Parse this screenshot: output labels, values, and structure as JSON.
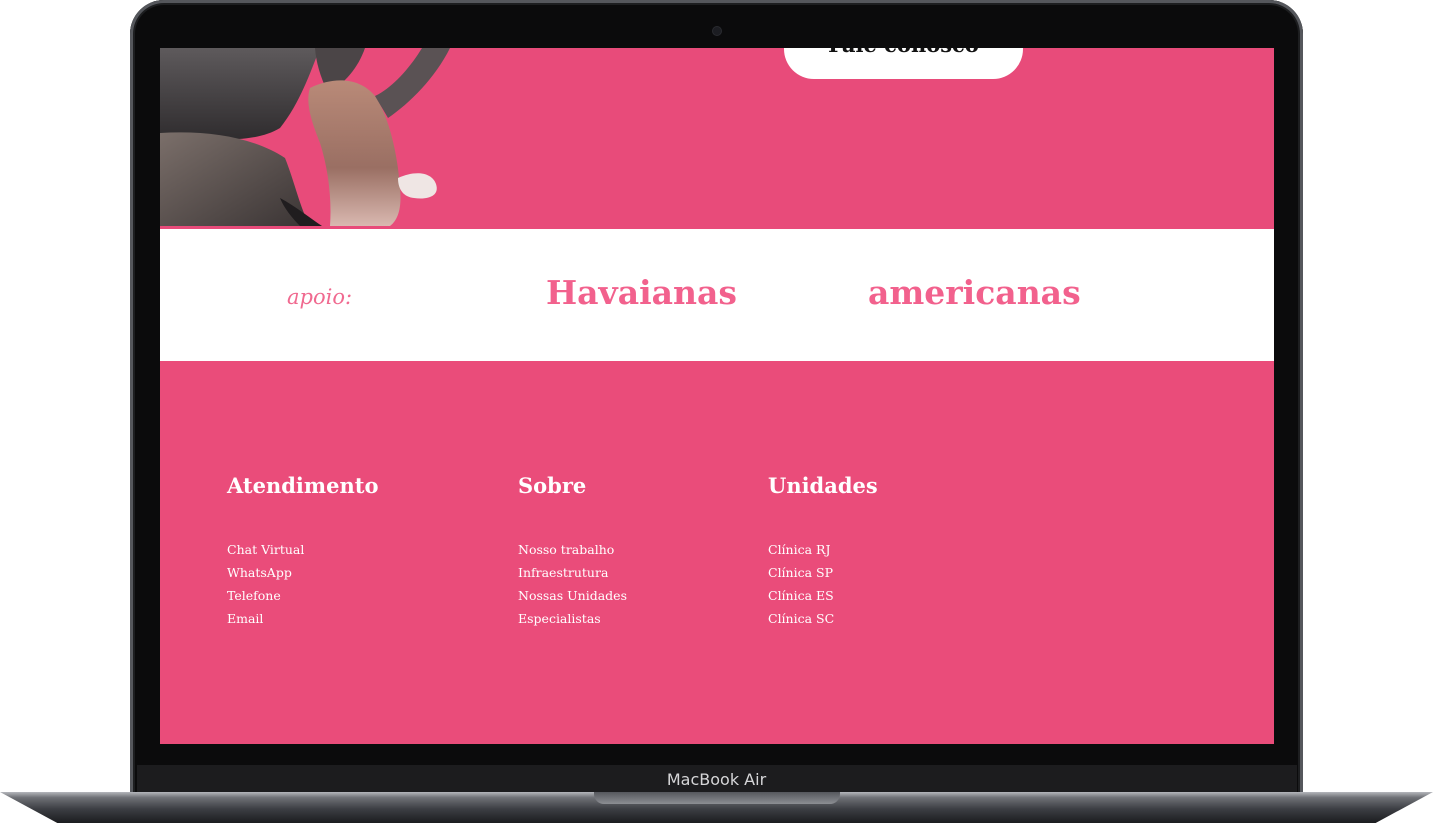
{
  "device": {
    "brand": "MacBook Air"
  },
  "hero": {
    "contact_button": "Fale conosco"
  },
  "support": {
    "label": "apoio:",
    "sponsors": [
      "Havaianas",
      "americanas"
    ]
  },
  "footer": {
    "columns": [
      {
        "title": "Atendimento",
        "links": [
          "Chat Virtual",
          "WhatsApp",
          "Telefone",
          "Email"
        ]
      },
      {
        "title": "Sobre",
        "links": [
          "Nosso trabalho",
          "Infraestrutura",
          "Nossas Unidades",
          "Especialistas"
        ]
      },
      {
        "title": "Unidades",
        "links": [
          "Clínica RJ",
          "Clínica SP",
          "Clínica ES",
          "Clínica SC"
        ]
      }
    ]
  },
  "colors": {
    "brand_pink": "#ea4c7a",
    "sponsor_pink": "#f2618d",
    "white": "#ffffff"
  }
}
